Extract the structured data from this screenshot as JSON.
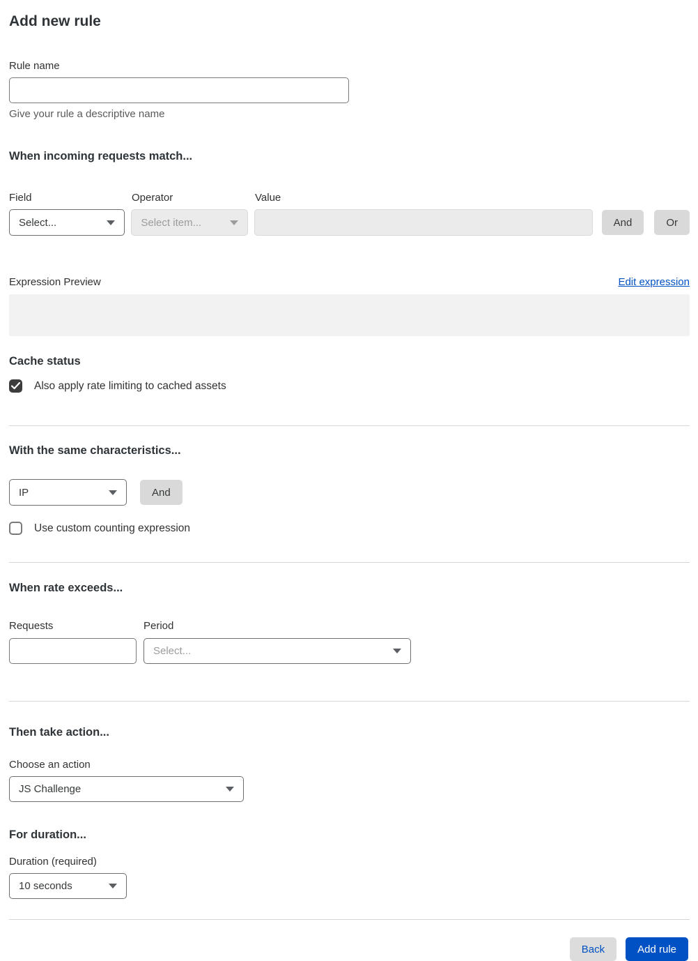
{
  "page": {
    "title": "Add new rule"
  },
  "rule_name": {
    "label": "Rule name",
    "value": "",
    "help": "Give your rule a descriptive name"
  },
  "match": {
    "heading": "When incoming requests match...",
    "field": {
      "label": "Field",
      "value": "Select..."
    },
    "operator": {
      "label": "Operator",
      "value": "Select item..."
    },
    "value": {
      "label": "Value",
      "value": ""
    },
    "and_label": "And",
    "or_label": "Or"
  },
  "expression": {
    "label": "Expression Preview",
    "edit_link": "Edit expression",
    "content": ""
  },
  "cache_status": {
    "heading": "Cache status",
    "checkbox_label": "Also apply rate limiting to cached assets",
    "checked": true
  },
  "characteristics": {
    "heading": "With the same characteristics...",
    "select_value": "IP",
    "and_label": "And",
    "checkbox_label": "Use custom counting expression",
    "checked": false
  },
  "rate": {
    "heading": "When rate exceeds...",
    "requests": {
      "label": "Requests",
      "value": ""
    },
    "period": {
      "label": "Period",
      "value": "Select..."
    }
  },
  "action": {
    "heading": "Then take action...",
    "label": "Choose an action",
    "value": "JS Challenge"
  },
  "duration": {
    "heading": "For duration...",
    "label": "Duration (required)",
    "value": "10 seconds"
  },
  "footer": {
    "back_label": "Back",
    "add_label": "Add rule"
  },
  "colors": {
    "primary": "#0051c3",
    "link": "#0051c3",
    "divider": "#d6d6d6",
    "disabled_bg": "#ebebeb",
    "gray_button_bg": "#d9d9d9",
    "preview_bg": "#f2f2f2",
    "text": "#313131",
    "muted_text": "#9c9c9c",
    "checkbox_checked_bg": "#3d3d3d"
  }
}
